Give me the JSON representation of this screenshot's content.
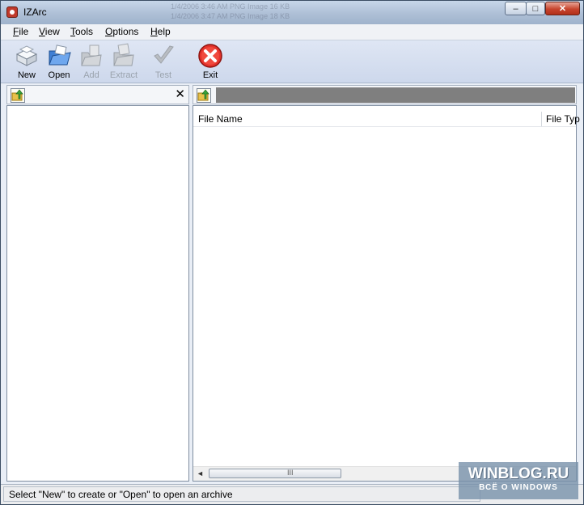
{
  "window": {
    "title": "IZArc",
    "blurred_lines": [
      "1/4/2006 3:46 AM    PNG Image    16 KB",
      "1/4/2006 3:47 AM    PNG Image    18 KB"
    ],
    "controls": {
      "minimize": "–",
      "maximize": "□",
      "close": "✕"
    }
  },
  "menu": [
    {
      "label": "File"
    },
    {
      "label": "View"
    },
    {
      "label": "Tools"
    },
    {
      "label": "Options"
    },
    {
      "label": "Help"
    }
  ],
  "toolbar": [
    {
      "label": "New",
      "icon": "new-archive-icon",
      "enabled": true
    },
    {
      "label": "Open",
      "icon": "open-folder-icon",
      "enabled": true
    },
    {
      "label": "Add",
      "icon": "add-files-icon",
      "enabled": false
    },
    {
      "label": "Extract",
      "icon": "extract-folder-icon",
      "enabled": false
    },
    {
      "label": "Test",
      "icon": "check-icon",
      "enabled": false
    },
    {
      "label": "Exit",
      "icon": "exit-icon",
      "enabled": true
    }
  ],
  "left_panel": {
    "close_glyph": "✕"
  },
  "file_list": {
    "columns": [
      "File Name",
      "File Typ"
    ]
  },
  "scrollbar": {
    "left_arrow": "◄",
    "grip": "III"
  },
  "status": {
    "text": "Select \"New\" to create or \"Open\" to open an archive"
  },
  "watermark": {
    "line1": "WINBLOG.RU",
    "line2": "ВСЁ О WINDOWS"
  }
}
